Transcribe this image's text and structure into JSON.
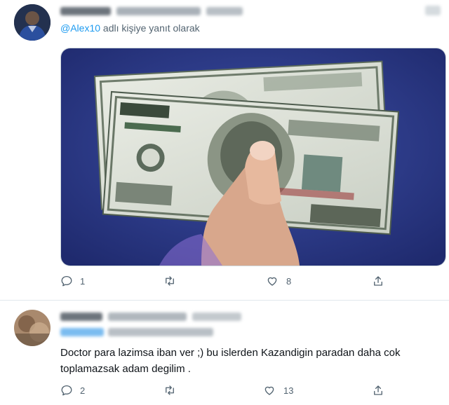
{
  "tweet1": {
    "reply_prefix": "@Alex10",
    "reply_suffix": " adlı kişiye yanıt olarak",
    "media_icon": "hundred-dollar-bills-in-hand-photo",
    "actions": {
      "reply_count": "1",
      "retweet_count": "",
      "like_count": "8",
      "share_count": ""
    }
  },
  "tweet2": {
    "text": "Doctor para lazimsa iban ver ;) bu islerden Kazandigin paradan daha cok toplamazsak adam degilim .",
    "actions": {
      "reply_count": "2",
      "retweet_count": "",
      "like_count": "13",
      "share_count": ""
    }
  },
  "colors": {
    "accent": "#1d9bf0",
    "muted": "#536471",
    "photo_background": "#2e3d8f"
  },
  "icons": [
    "reply-icon",
    "retweet-icon",
    "like-icon",
    "share-icon"
  ]
}
